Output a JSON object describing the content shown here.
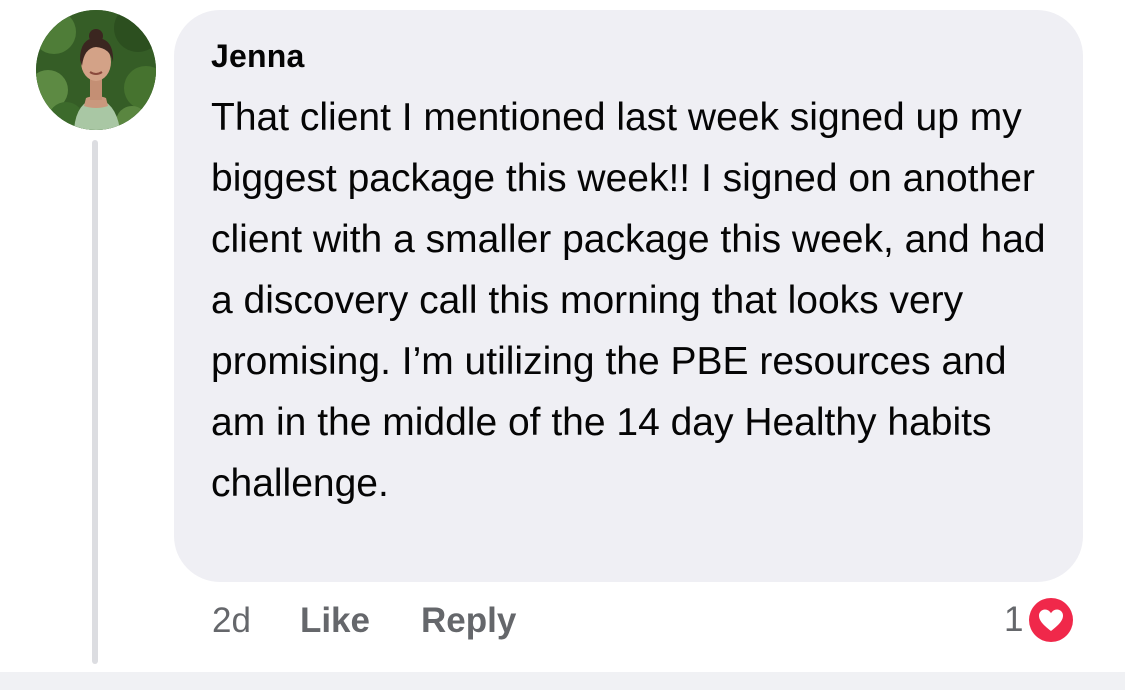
{
  "comment": {
    "author": "Jenna",
    "text": "That client I mentioned last week signed up my biggest package this week!! I signed on another client with a smaller package this week, and had a discovery call this morning that looks very promising. I’m utilizing the PBE resources and am in the middle of the 14 day Healthy habits challenge.",
    "timestamp": "2d",
    "like_label": "Like",
    "reply_label": "Reply",
    "reaction_count": "1",
    "reaction_icon": "heart-icon"
  },
  "colors": {
    "bubble_background": "#efeff4",
    "meta_text": "#65676b",
    "heart": "#f0284a"
  }
}
